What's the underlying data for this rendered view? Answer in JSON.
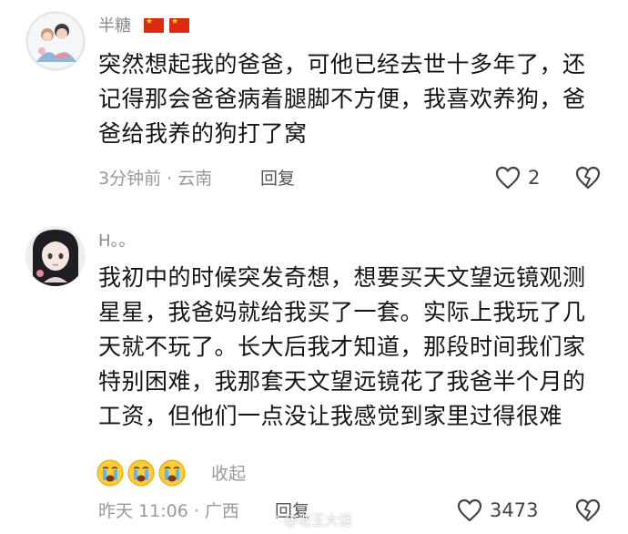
{
  "comments": [
    {
      "username": "半糖",
      "text_lines": [
        "突然想起我的爸爸，可他已经去世十多年了，还",
        "记得那会爸爸病着腿脚不方便，我喜欢养狗，爸",
        "爸给我养的狗打了窝"
      ],
      "meta": "3分钟前 · 云南",
      "reply_label": "回复",
      "like_count": "2"
    },
    {
      "username": "H。。",
      "text_lines": [
        "我初中的时候突发奇想，想要买天文望远镜观测",
        "星星，我爸妈就给我买了一套。实际上我玩了几",
        "天就不玩了。长大后我才知道，那段时间我们家",
        "特别困难，我那套天文望远镜花了我爸半个月的",
        "工资，但他们一点没让我感觉到家里过得很难"
      ],
      "collapse_label": "收起",
      "meta": "昨天 11:06 · 广西",
      "reply_label": "回复",
      "like_count": "3473"
    }
  ],
  "watermark": "@老王大话",
  "colors": {
    "flag_red": "#de2910",
    "flag_star": "#ffde00",
    "muted_text": "#9a9a9a"
  },
  "icons": [
    "flag-icon",
    "heart-outline-icon",
    "broken-heart-icon",
    "crying-emoji-icon",
    "weibo-logo-icon"
  ]
}
